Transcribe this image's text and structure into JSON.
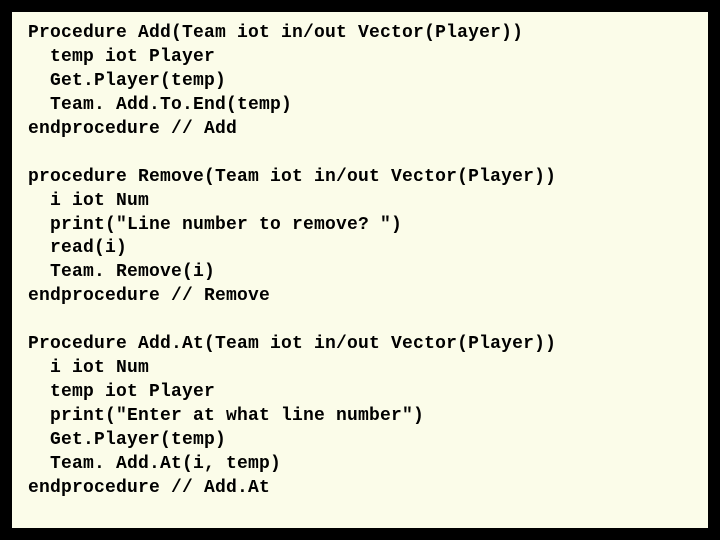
{
  "code": {
    "lines": [
      "Procedure Add(Team iot in/out Vector(Player))",
      "  temp iot Player",
      "  Get.Player(temp)",
      "  Team. Add.To.End(temp)",
      "endprocedure // Add",
      "",
      "procedure Remove(Team iot in/out Vector(Player))",
      "  i iot Num",
      "  print(\"Line number to remove? \")",
      "  read(i)",
      "  Team. Remove(i)",
      "endprocedure // Remove",
      "",
      "Procedure Add.At(Team iot in/out Vector(Player))",
      "  i iot Num",
      "  temp iot Player",
      "  print(\"Enter at what line number\")",
      "  Get.Player(temp)",
      "  Team. Add.At(i, temp)",
      "endprocedure // Add.At"
    ]
  }
}
